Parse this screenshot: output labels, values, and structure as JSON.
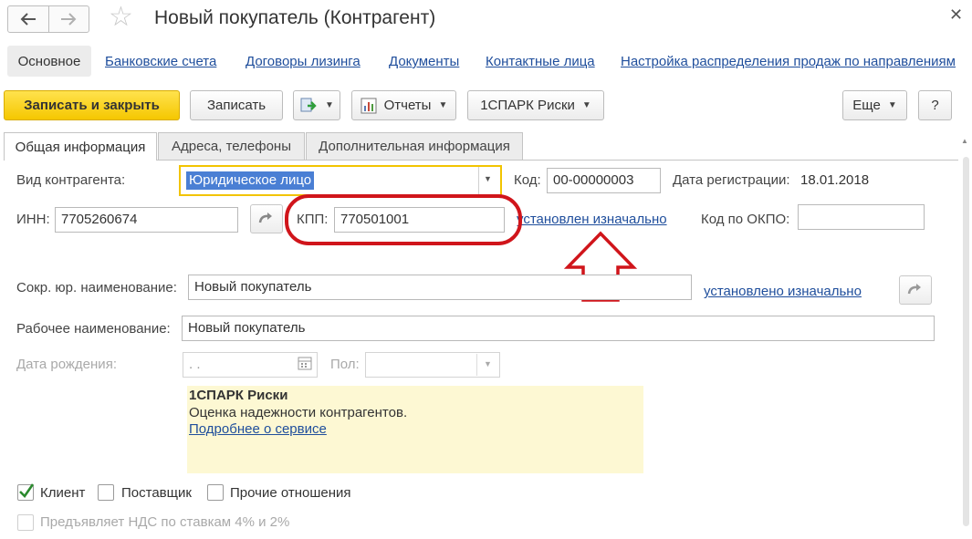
{
  "window": {
    "title": "Новый покупатель (Контрагент)",
    "back_icon": "arrow-left-icon",
    "forward_icon": "arrow-right-icon",
    "favorite_icon": "star-icon",
    "close_icon": "close-icon"
  },
  "nav": {
    "active": "Основное",
    "links": [
      "Банковские счета",
      "Договоры лизинга",
      "Документы",
      "Контактные лица",
      "Настройка распределения продаж по направлениям"
    ]
  },
  "toolbar": {
    "save_close": "Записать и закрыть",
    "save": "Записать",
    "reports": "Отчеты",
    "spark": "1СПАРК Риски",
    "more": "Еще",
    "help": "?"
  },
  "tabs": [
    "Общая информация",
    "Адреса, телефоны",
    "Дополнительная информация"
  ],
  "form": {
    "type_label": "Вид контрагента:",
    "type_value": "Юридическое лицо",
    "code_label": "Код:",
    "code_value": "00-00000003",
    "regdate_label": "Дата регистрации:",
    "regdate_value": "18.01.2018",
    "inn_label": "ИНН:",
    "inn_value": "7705260674",
    "kpp_label": "КПП:",
    "kpp_value": "770501001",
    "kpp_status": "установлен изначально",
    "okpo_label": "Код по ОКПО:",
    "okpo_value": "",
    "short_name_label": "Сокр. юр. наименование:",
    "short_name_value": "Новый покупатель",
    "short_name_status": "установлено изначально",
    "work_name_label": "Рабочее наименование:",
    "work_name_value": "Новый покупатель",
    "birth_label": "Дата рождения:",
    "birth_value": " .  .",
    "gender_label": "Пол:",
    "gender_value": ""
  },
  "spark_info": {
    "title": "1СПАРК Риски",
    "text": "Оценка надежности контрагентов.",
    "link": "Подробнее о сервисе"
  },
  "relations": {
    "client": "Клиент",
    "client_checked": true,
    "supplier": "Поставщик",
    "supplier_checked": false,
    "other": "Прочие отношения",
    "other_checked": false,
    "vat": "Предъявляет НДС по ставкам 4% и 2%",
    "vat_checked": false
  },
  "colors": {
    "accent_yellow": "#f5c700",
    "link_blue": "#1f4e9c",
    "highlight_red": "#d0151b",
    "info_bg": "#fdf8d3"
  }
}
